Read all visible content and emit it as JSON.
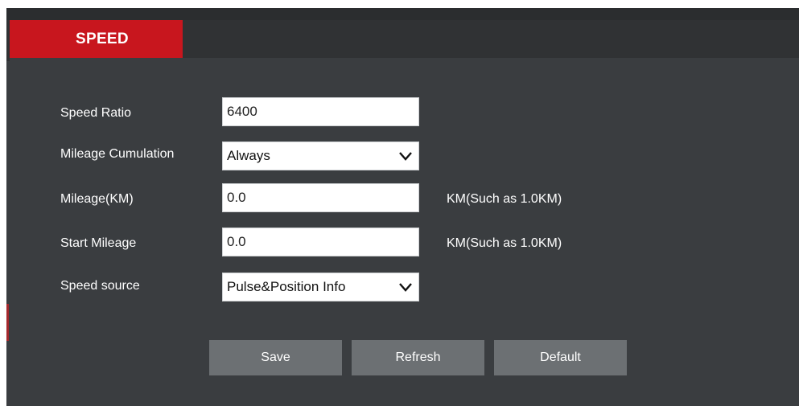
{
  "tabs": [
    {
      "label": "SPEED",
      "active": true
    }
  ],
  "colors": {
    "accent": "#c8161e",
    "panel": "#3a3d40",
    "button": "#6c7073"
  },
  "form": {
    "speed_ratio": {
      "label": "Speed Ratio",
      "value": "6400"
    },
    "mileage_cumulation": {
      "label": "Mileage Cumulation",
      "value": "Always"
    },
    "mileage": {
      "label": "Mileage(KM)",
      "value": "0.0",
      "hint": "KM(Such as 1.0KM)"
    },
    "start_mileage": {
      "label": "Start Mileage",
      "value": "0.0",
      "hint": "KM(Such as 1.0KM)"
    },
    "speed_source": {
      "label": "Speed source",
      "value": "Pulse&Position Info"
    }
  },
  "buttons": {
    "save": "Save",
    "refresh": "Refresh",
    "default": "Default"
  }
}
